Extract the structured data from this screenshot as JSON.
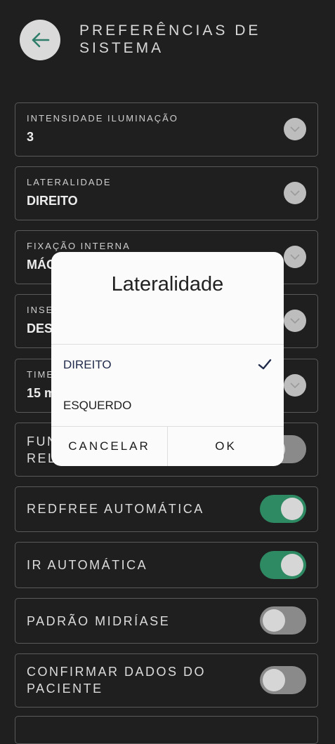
{
  "header": {
    "title": "PREFERÊNCIAS DE SISTEMA"
  },
  "rows": [
    {
      "small": "INTENSIDADE ILUMINAÇÃO",
      "value": "3"
    },
    {
      "small": "LATERALIDADE",
      "value": "DIREITO"
    },
    {
      "small": "FIXAÇÃO INTERNA",
      "value": "MÁC"
    },
    {
      "small": "INSE",
      "value": "DES"
    },
    {
      "small": "TIME",
      "value": "15 m"
    },
    {
      "label": "FUN\nREL"
    },
    {
      "label": "REDFREE AUTOMÁTICA",
      "on": true
    },
    {
      "label": "IR AUTOMÁTICA",
      "on": true
    },
    {
      "label": "PADRÃO MIDRÍASE",
      "on": false
    },
    {
      "label": "CONFIRMAR DADOS DO PACIENTE",
      "on": false
    }
  ],
  "dialog": {
    "title": "Lateralidade",
    "options": [
      "DIREITO",
      "ESQUERDO"
    ],
    "selected_option": "DIREITO",
    "cancel": "CANCELAR",
    "ok": "OK"
  },
  "colors": {
    "accent": "#2e8a63",
    "background": "#1f1f1f",
    "selected_text": "#1f2a4a"
  }
}
